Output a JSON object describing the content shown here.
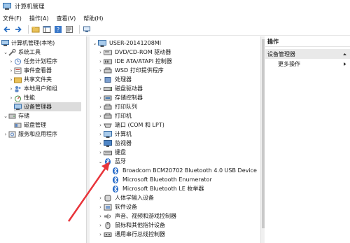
{
  "window": {
    "title": "计算机管理"
  },
  "menu": [
    "文件(F)",
    "操作(A)",
    "查看(V)",
    "帮助(H)"
  ],
  "tree": {
    "root": "计算机管理(本地)",
    "system_tools": "系统工具",
    "task_scheduler": "任务计划程序",
    "event_viewer": "事件查看器",
    "shared_folders": "共享文件夹",
    "local_users": "本地用户和组",
    "performance": "性能",
    "device_manager": "设备管理器",
    "storage": "存储",
    "disk_management": "磁盘管理",
    "services": "服务和应用程序"
  },
  "devices": {
    "computer_name": "USER-20141208MI",
    "dvd": "DVD/CD-ROM 驱动器",
    "ide": "IDE ATA/ATAPI 控制器",
    "wsd": "WSD 打印提供程序",
    "processor": "处理器",
    "disk": "磁盘驱动器",
    "storage_ctrl": "存储控制器",
    "print_queue": "打印队列",
    "printer": "打印机",
    "ports": "端口 (COM 和 LPT)",
    "computer": "计算机",
    "monitor": "监视器",
    "keyboard": "键盘",
    "bluetooth": "蓝牙",
    "bt1": "Broadcom BCM20702 Bluetooth 4.0 USB Device",
    "bt2": "Microsoft Bluetooth Enumerator",
    "bt3": "Microsoft Bluetooth LE 枚举器",
    "hid": "人体学输入设备",
    "software": "软件设备",
    "sound": "声音、视频和游戏控制器",
    "mouse": "鼠标和其他指针设备",
    "usb": "通用串行总线控制器"
  },
  "actions": {
    "header": "操作",
    "section": "设备管理器",
    "more": "更多操作"
  },
  "colors": {
    "accent": "#0c6cc4",
    "bluetooth": "#1b63c6",
    "annotation_arrow": "#e8343a"
  }
}
